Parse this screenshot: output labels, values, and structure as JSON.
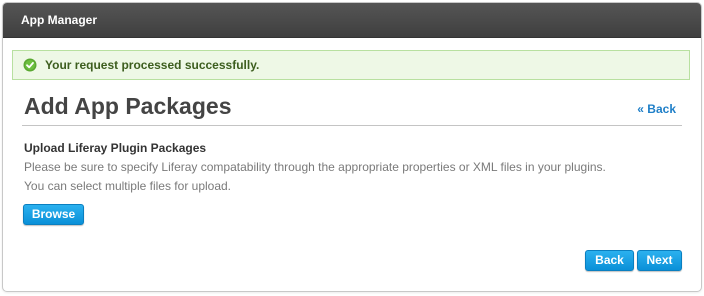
{
  "portlet": {
    "title": "App Manager"
  },
  "alert": {
    "message": "Your request processed successfully.",
    "icon": "success-check-icon"
  },
  "header": {
    "title": "Add App Packages",
    "back_link": "« Back"
  },
  "upload": {
    "heading": "Upload Liferay Plugin Packages",
    "help_line_1": "Please be sure to specify Liferay compatability through the appropriate properties or XML files in your plugins.",
    "help_line_2": "You can select multiple files for upload.",
    "browse_label": "Browse"
  },
  "footer": {
    "back_label": "Back",
    "next_label": "Next"
  },
  "colors": {
    "accent": "#1f7fc8",
    "button": "#0a90d8",
    "success_bg": "#eef8e6",
    "title_bar": "#444444"
  }
}
